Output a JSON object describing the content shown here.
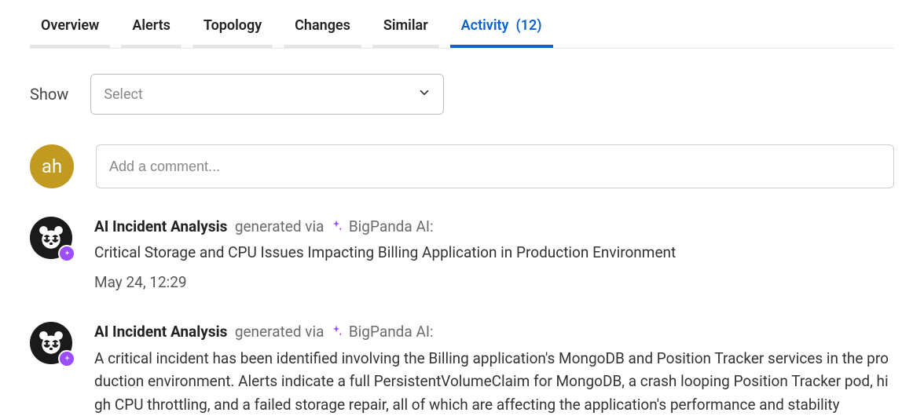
{
  "tabs": [
    {
      "label": "Overview",
      "active": false
    },
    {
      "label": "Alerts",
      "active": false
    },
    {
      "label": "Topology",
      "active": false
    },
    {
      "label": "Changes",
      "active": false
    },
    {
      "label": "Similar",
      "active": false
    },
    {
      "label": "Activity",
      "count": "(12)",
      "active": true
    }
  ],
  "filter": {
    "label": "Show",
    "placeholder": "Select"
  },
  "comment": {
    "avatar_initials": "ah",
    "placeholder": "Add a comment..."
  },
  "ai_source": {
    "title": "AI Incident Analysis",
    "via_prefix": "generated via",
    "via_name": "BigPanda AI:"
  },
  "activity": [
    {
      "content": "Critical Storage and CPU Issues Impacting Billing Application in Production Environment",
      "timestamp": "May 24, 12:29"
    },
    {
      "content": "A critical incident has been identified involving the Billing application's MongoDB and Position Tracker services in the production environment. Alerts indicate a full PersistentVolumeClaim for MongoDB, a crash looping Position Tracker pod, high CPU throttling, and a failed storage repair, all of which are affecting the application's performance and stability"
    }
  ]
}
